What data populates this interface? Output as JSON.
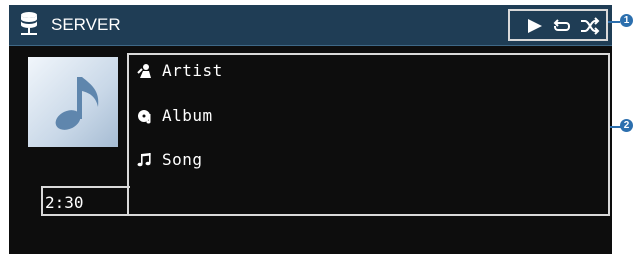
{
  "header": {
    "source_icon": "server-icon",
    "source_label": "SERVER",
    "status_icons": [
      "play-icon",
      "repeat-icon",
      "shuffle-icon"
    ]
  },
  "now_playing": {
    "album_art_icon": "music-note-icon",
    "artist": "Artist",
    "album": "Album",
    "song": "Song",
    "elapsed_time": "2:30"
  },
  "callouts": {
    "one": "1",
    "two": "2"
  },
  "colors": {
    "header_bg": "#1f3d55",
    "screen_bg": "#0d0d0d",
    "callout": "#2c6fae",
    "highlight_border": "#d9d9d9"
  }
}
